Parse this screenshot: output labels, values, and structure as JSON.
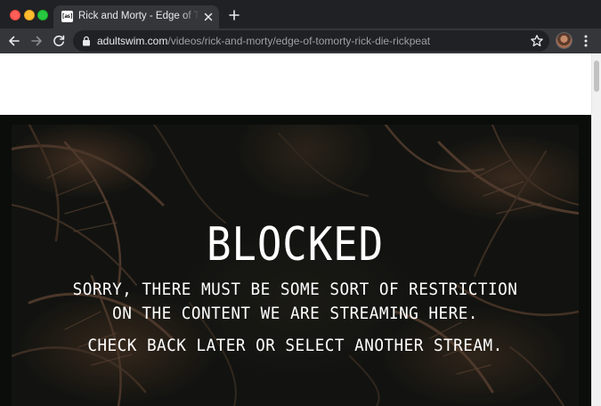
{
  "browser": {
    "tab": {
      "favicon_text": "[as]",
      "title": "Rick and Morty - Edge of Tomorty: Rick Die Rickpeat"
    },
    "address_bar": {
      "host": "adultswim.com",
      "path": "/videos/rick-and-morty/edge-of-tomorty-rick-die-rickpeat"
    }
  },
  "player": {
    "title": "BLOCKED",
    "message_line1": "SORRY, THERE MUST BE SOME SORT OF RESTRICTION",
    "message_line2": "ON THE CONTENT WE ARE STREAMING HERE.",
    "message_line3": "CHECK BACK LATER OR SELECT ANOTHER STREAM."
  },
  "icons": {
    "close": "close-icon",
    "new_tab": "plus-icon",
    "back": "arrow-left-icon",
    "forward": "arrow-right-icon",
    "reload": "reload-icon",
    "secure": "lock-icon",
    "bookmark": "star-icon",
    "menu": "kebab-menu-icon"
  },
  "colors": {
    "chrome_dark": "#202124",
    "toolbar": "#35363a",
    "blocked_text": "#ffffff"
  }
}
